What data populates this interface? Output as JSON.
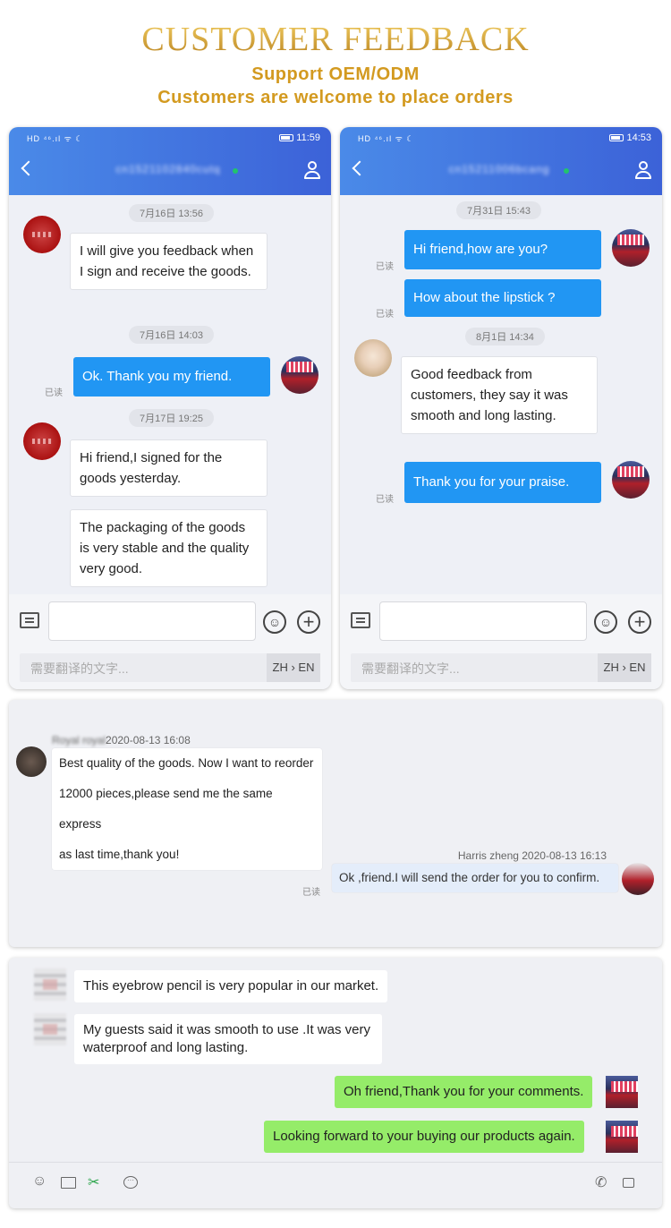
{
  "header": {
    "title": "CUSTOMER FEEDBACK",
    "subtitle1": "Support OEM/ODM",
    "subtitle2": "Customers are welcome to place orders"
  },
  "colors": {
    "gold": "#d39a20",
    "blue_bar": "#3c62d8",
    "out_bubble": "#2196f3",
    "wechat_green": "#95ec69"
  },
  "phone1": {
    "status": {
      "signal": "HD ⁴⁶.ıl ᯤ ☾",
      "time": "11:59"
    },
    "contact": "cn1521102840cutq",
    "timestamps": [
      "7月16日 13:56",
      "7月16日 14:03",
      "7月17日 19:25"
    ],
    "messages": [
      {
        "text": "I will give you feedback when I sign and receive the goods."
      },
      {
        "text": "Ok. Thank you my friend.",
        "read": "已读"
      },
      {
        "text": "Hi friend,I signed for the goods yesterday."
      },
      {
        "text": "The packaging of the goods is very stable and the quality very good."
      }
    ],
    "translate_placeholder": "需要翻译的文字...",
    "lang": "ZH › EN"
  },
  "phone2": {
    "status": {
      "signal": "HD ⁴⁶.ıl ᯤ ☾",
      "time": "14:53"
    },
    "contact": "cn15211006bcang",
    "timestamps": [
      "7月31日 15:43",
      "8月1日 14:34"
    ],
    "messages": [
      {
        "text": "Hi friend,how are you?",
        "read": "已读"
      },
      {
        "text": "How about the lipstick ?",
        "read": "已读"
      },
      {
        "text": "Good feedback from customers, they say it was smooth and long lasting."
      },
      {
        "text": "Thank you for your praise.",
        "read": "已读"
      }
    ],
    "translate_placeholder": "需要翻译的文字...",
    "lang": "ZH › EN"
  },
  "panel1": {
    "sender": "Royal royal",
    "sender_time": "2020-08-13 16:08",
    "msg1": [
      "Best quality of the goods. Now I want to reorder",
      "12000 pieces,please send me the same express",
      "as last time,thank you!"
    ],
    "reply_name": "Harris  zheng 2020-08-13 16:13",
    "reply": "Ok ,friend.I will send the order for you to confirm.",
    "read": "已读"
  },
  "panel2": {
    "messages": [
      {
        "text": "This eyebrow pencil is very popular in our market."
      },
      {
        "text": "My guests said it was smooth to use .It was very waterproof and long lasting."
      },
      {
        "text": "Oh friend,Thank you for your comments."
      },
      {
        "text": "Looking forward to your buying our products again."
      }
    ],
    "icons": [
      "smiley-icon",
      "folder-icon",
      "scissors-icon",
      "chat-icon",
      "phone-icon",
      "video-icon"
    ]
  }
}
